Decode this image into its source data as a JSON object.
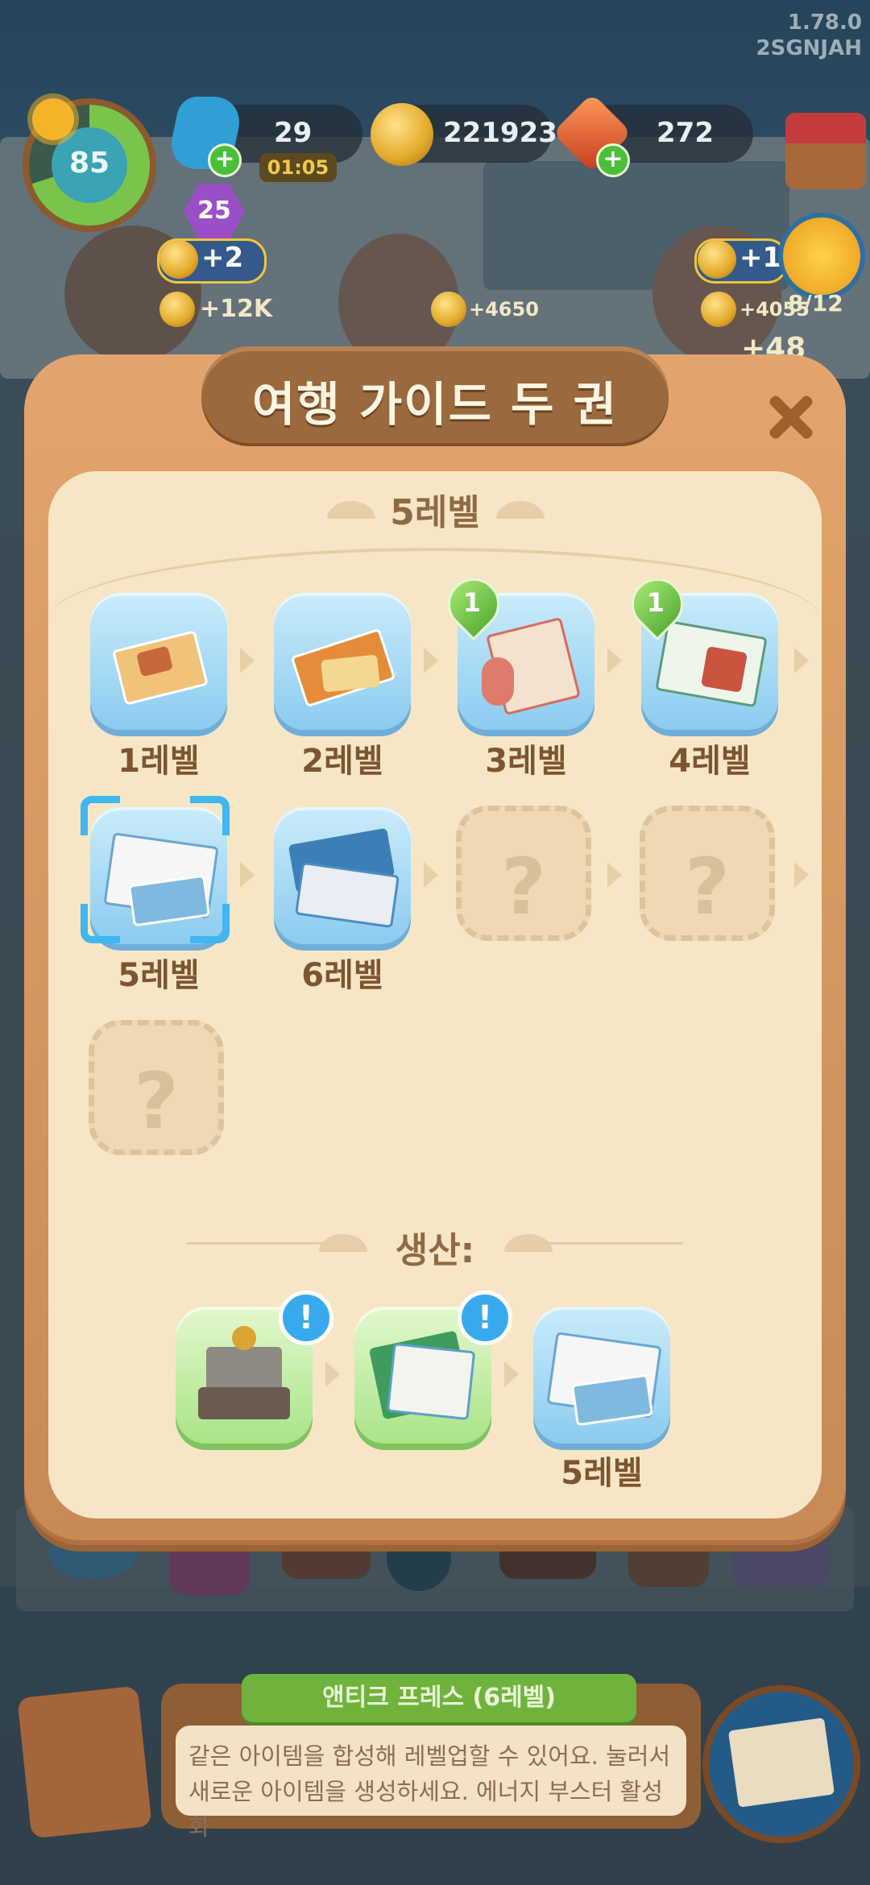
{
  "version": "1.78.0",
  "player_id": "2SGNJAH",
  "hud": {
    "level": "85",
    "energy": "29",
    "energy_timer": "01:05",
    "coins": "221923",
    "gems": "272",
    "event_badge": "25"
  },
  "characters": [
    {
      "bonus": "+2",
      "reward": "+12K"
    },
    {
      "reward": "+4650"
    },
    {
      "bonus": "+1",
      "reward": "+4055",
      "progress": "8/12",
      "extra": "+48"
    }
  ],
  "modal": {
    "title": "여행 가이드 두 권",
    "current_level_title": "5레벨",
    "chain": [
      {
        "label": "1레벨",
        "unlocked": true,
        "count_badge": null
      },
      {
        "label": "2레벨",
        "unlocked": true,
        "count_badge": null
      },
      {
        "label": "3레벨",
        "unlocked": true,
        "count_badge": "1"
      },
      {
        "label": "4레벨",
        "unlocked": true,
        "count_badge": "1"
      },
      {
        "label": "5레벨",
        "unlocked": true,
        "selected": true
      },
      {
        "label": "6레벨",
        "unlocked": true
      },
      {
        "label": "",
        "unlocked": false,
        "placeholder": "?"
      },
      {
        "label": "",
        "unlocked": false,
        "placeholder": "?"
      },
      {
        "label": "",
        "unlocked": false,
        "placeholder": "?"
      }
    ],
    "produced_by_title": "생산:",
    "produced_by": [
      {
        "type": "antique-press",
        "alert": "!"
      },
      {
        "type": "brochure-stack",
        "alert": "!"
      },
      {
        "type": "travel-guide",
        "label": "5레벨"
      }
    ]
  },
  "info_panel": {
    "item_name": "앤티크 프레스 (6레벨)",
    "description_line1": "같은 아이템을 합성해 레벨업할 수 있어요. 눌러서",
    "description_line2": "새로운 아이템을 생성하세요. 에너지 부스터 활성화"
  },
  "colors": {
    "modal_frame": "#d99a60",
    "modal_inner": "#f6e6c6",
    "tile_blue": "#8ccbef",
    "tile_green": "#a9e487",
    "label_brown": "#7d5530",
    "select_cyan": "#3fb7ef"
  }
}
